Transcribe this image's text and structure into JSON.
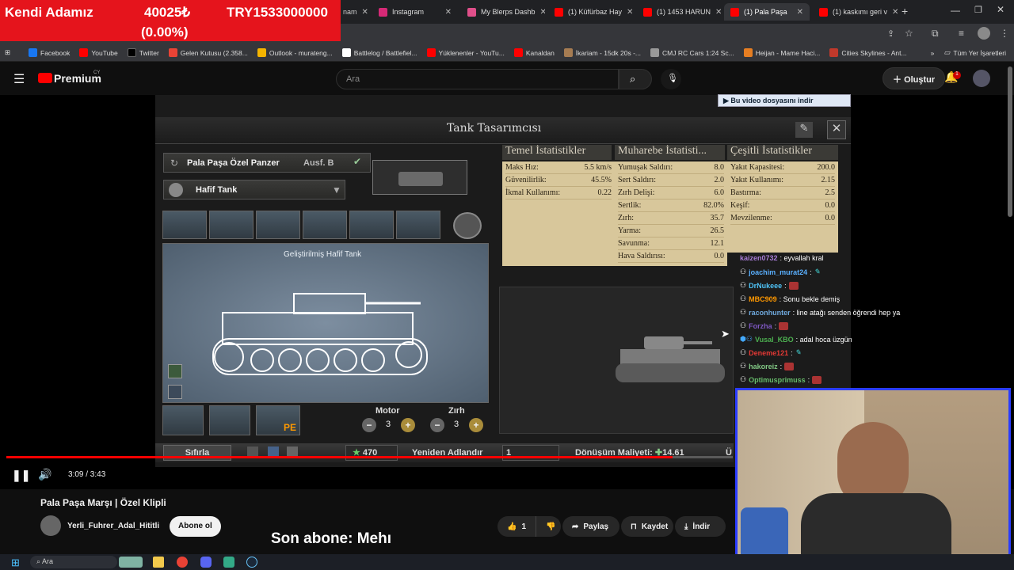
{
  "ticker": {
    "name": "Kendi Adamız",
    "value": "40025₺",
    "target": "TRY1533000000",
    "percent": "(0.00%)"
  },
  "tabs": [
    {
      "label": "Instagram",
      "color": "#d62976"
    },
    {
      "label": "My Blerps Dashb",
      "color": "#e04f8a"
    },
    {
      "label": "(1) Küfürbaz Hay",
      "color": "#f00"
    },
    {
      "label": "(1) 1453 HARUN",
      "color": "#f00"
    },
    {
      "label": "(1) Pala Paşa",
      "color": "#f00"
    },
    {
      "label": "(1) kaskımı geri v",
      "color": "#f00"
    }
  ],
  "bookmarks": [
    "Facebook",
    "YouTube",
    "Twitter",
    "Gelen Kutusu (2.358...",
    "Outlook - murateng...",
    "Battlelog / Battlefiel...",
    "Yüklenenler - YouTu...",
    "Kanaldan",
    "İkariam - 15dk 20s -...",
    "CMJ RC Cars 1:24 Sc...",
    "Heijan - Mame Haci...",
    "Cities Skylines - Ant..."
  ],
  "bookmarks_all": "Tüm Yer İşaretleri",
  "yt": {
    "premium": "Premium",
    "cy": "CY",
    "search_placeholder": "Ara",
    "create": "Oluştur",
    "notif_count": "1"
  },
  "download_banner": "Bu video dosyasını indir",
  "game": {
    "window_title": "Tank Tasarımcısı",
    "design_name": "Pala Paşa Özel Panzer",
    "ausf": "Ausf. B",
    "tank_type": "Hafif Tank",
    "blueprint_label": "Geliştirilmiş Hafif Tank",
    "headers": [
      "Temel İstatistikler",
      "Muharebe İstatisti...",
      "Çeşitli İstatistikler"
    ],
    "basic": [
      {
        "k": "Maks Hız:",
        "v": "5.5 km/s"
      },
      {
        "k": "Güvenilirlik:",
        "v": "45.5%"
      },
      {
        "k": "İkmal Kullanımı:",
        "v": "0.22"
      }
    ],
    "combat": [
      {
        "k": "Yumuşak Saldırı:",
        "v": "8.0"
      },
      {
        "k": "Sert Saldırı:",
        "v": "2.0"
      },
      {
        "k": "Zırh Delişi:",
        "v": "6.0"
      },
      {
        "k": "Sertlik:",
        "v": "82.0%"
      },
      {
        "k": "Zırh:",
        "v": "35.7"
      },
      {
        "k": "Yarma:",
        "v": "26.5"
      },
      {
        "k": "Savunma:",
        "v": "12.1"
      },
      {
        "k": "Hava Saldırısı:",
        "v": "0.0"
      }
    ],
    "misc": [
      {
        "k": "Yakıt Kapasitesi:",
        "v": "200.0"
      },
      {
        "k": "Yakıt Kullanımı:",
        "v": "2.15"
      },
      {
        "k": "Bastırma:",
        "v": "2.5"
      },
      {
        "k": "Keşif:",
        "v": "0.0"
      },
      {
        "k": "Mevzilenme:",
        "v": "0.0"
      }
    ],
    "motor_label": "Motor",
    "motor_value": "3",
    "armor_label": "Zırh",
    "armor_value": "3",
    "reset": "Sıfırla",
    "cost": "470",
    "rename": "Yeniden Adlandır",
    "count": "1",
    "conversion": "Dönüşüm Maliyeti:",
    "conversion_value": "14.61",
    "u_letter": "Ü"
  },
  "chat": [
    {
      "user": "kaizen0732",
      "msg": ": eyvallah kral",
      "color": "#a77cd6"
    },
    {
      "user": "joachim_murat24",
      "msg": ":",
      "color": "#5ab0ff"
    },
    {
      "user": "DrNukeee",
      "msg": ":",
      "color": "#4fc3f7"
    },
    {
      "user": "MBC909",
      "msg": ": Sonu bekle demiş",
      "color": "#ff9800"
    },
    {
      "user": "raconhunter",
      "msg": ": line atağı senden öğrendi hep ya",
      "color": "#6fa8dc"
    },
    {
      "user": "Forzha",
      "msg": ":",
      "color": "#7e57c2"
    },
    {
      "user": "Vusal_KBO",
      "msg": ": adal hoca üzgün",
      "color": "#4caf50"
    },
    {
      "user": "Deneme121",
      "msg": ":",
      "color": "#e53935"
    },
    {
      "user": "hakoreiz",
      "msg": ":",
      "color": "#81c784"
    },
    {
      "user": "Optimusprimuss",
      "msg": ":",
      "color": "#66bb6a"
    }
  ],
  "player": {
    "time": "3:09 / 3:43",
    "progress": 0.917
  },
  "video": {
    "title": "Pala Paşa Marşı | Özel Klipli",
    "channel": "Yerli_Fuhrer_Adal_Hititli",
    "subscribe": "Abone ol",
    "likes": "1",
    "share": "Paylaş",
    "save": "Kaydet",
    "download": "İndir",
    "last_sub": "Son abone: Mehı"
  },
  "taskbar": {
    "search": "Ara"
  }
}
